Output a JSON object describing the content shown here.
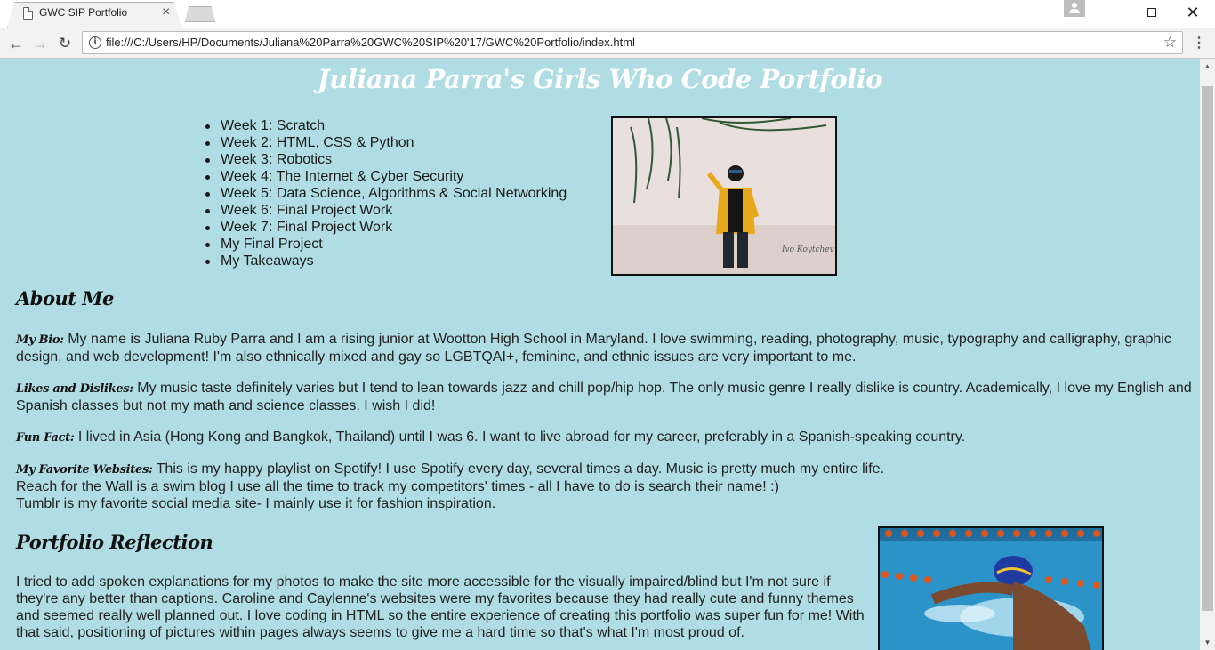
{
  "browser": {
    "tab_title": "GWC SIP Portfolio",
    "tab_close": "×",
    "url": "file:///C:/Users/HP/Documents/Juliana%20Parra%20GWC%20SIP%20'17/GWC%20Portfolio/index.html",
    "back": "←",
    "forward": "→",
    "reload": "↻",
    "star": "☆",
    "menu": "⋮",
    "close": "✕"
  },
  "page": {
    "title": "Juliana Parra's Girls Who Code Portfolio",
    "nav_links": [
      "Week 1: Scratch",
      "Week 2: HTML, CSS & Python",
      "Week 3: Robotics",
      "Week 4: The Internet & Cyber Security",
      "Week 5: Data Science, Algorithms & Social Networking",
      "Week 6: Final Project Work",
      "Week 7: Final Project Work",
      "My Final Project",
      "My Takeaways"
    ],
    "photo_credit": "Ivo Koytchev",
    "about": {
      "heading": "About Me",
      "bio_label": "My Bio:",
      "bio_text": " My name is Juliana Ruby Parra and I am a rising junior at Wootton High School in Maryland. I love swimming, reading, photography, music, typography and calligraphy, graphic design, and web development! I'm also ethnically mixed and gay so LGBTQAI+, feminine, and ethnic issues are very important to me.",
      "likes_label": "Likes and Dislikes:",
      "likes_text": " My music taste definitely varies but I tend to lean towards jazz and chill pop/hip hop. The only music genre I really dislike is country. Academically, I love my English and Spanish classes but not my math and science classes. I wish I did!",
      "fact_label": "Fun Fact:",
      "fact_text": " I lived in Asia (Hong Kong and Bangkok, Thailand) until I was 6. I want to live abroad for my career, preferably in a Spanish-speaking country.",
      "sites_label": "My Favorite Websites:",
      "sites_line1": " This is my happy playlist on Spotify! I use Spotify every day, several times a day. Music is pretty much my entire life.",
      "sites_line2": "Reach for the Wall is a swim blog I use all the time to track my competitors' times - all I have to do is search their name! :)",
      "sites_line3": "Tumblr is my favorite social media site- I mainly use it for fashion inspiration."
    },
    "reflection": {
      "heading": "Portfolio Reflection",
      "text": "I tried to add spoken explanations for my photos to make the site more accessible for the visually impaired/blind but I'm not sure if they're any better than captions. Caroline and Caylenne's websites were my favorites because they had really cute and funny themes and seemed really well planned out. I love coding in HTML so the entire experience of creating this portfolio was super fun for me! With that said, positioning of pictures within pages always seems to give me a hard time so that's what I'm most proud of."
    }
  }
}
